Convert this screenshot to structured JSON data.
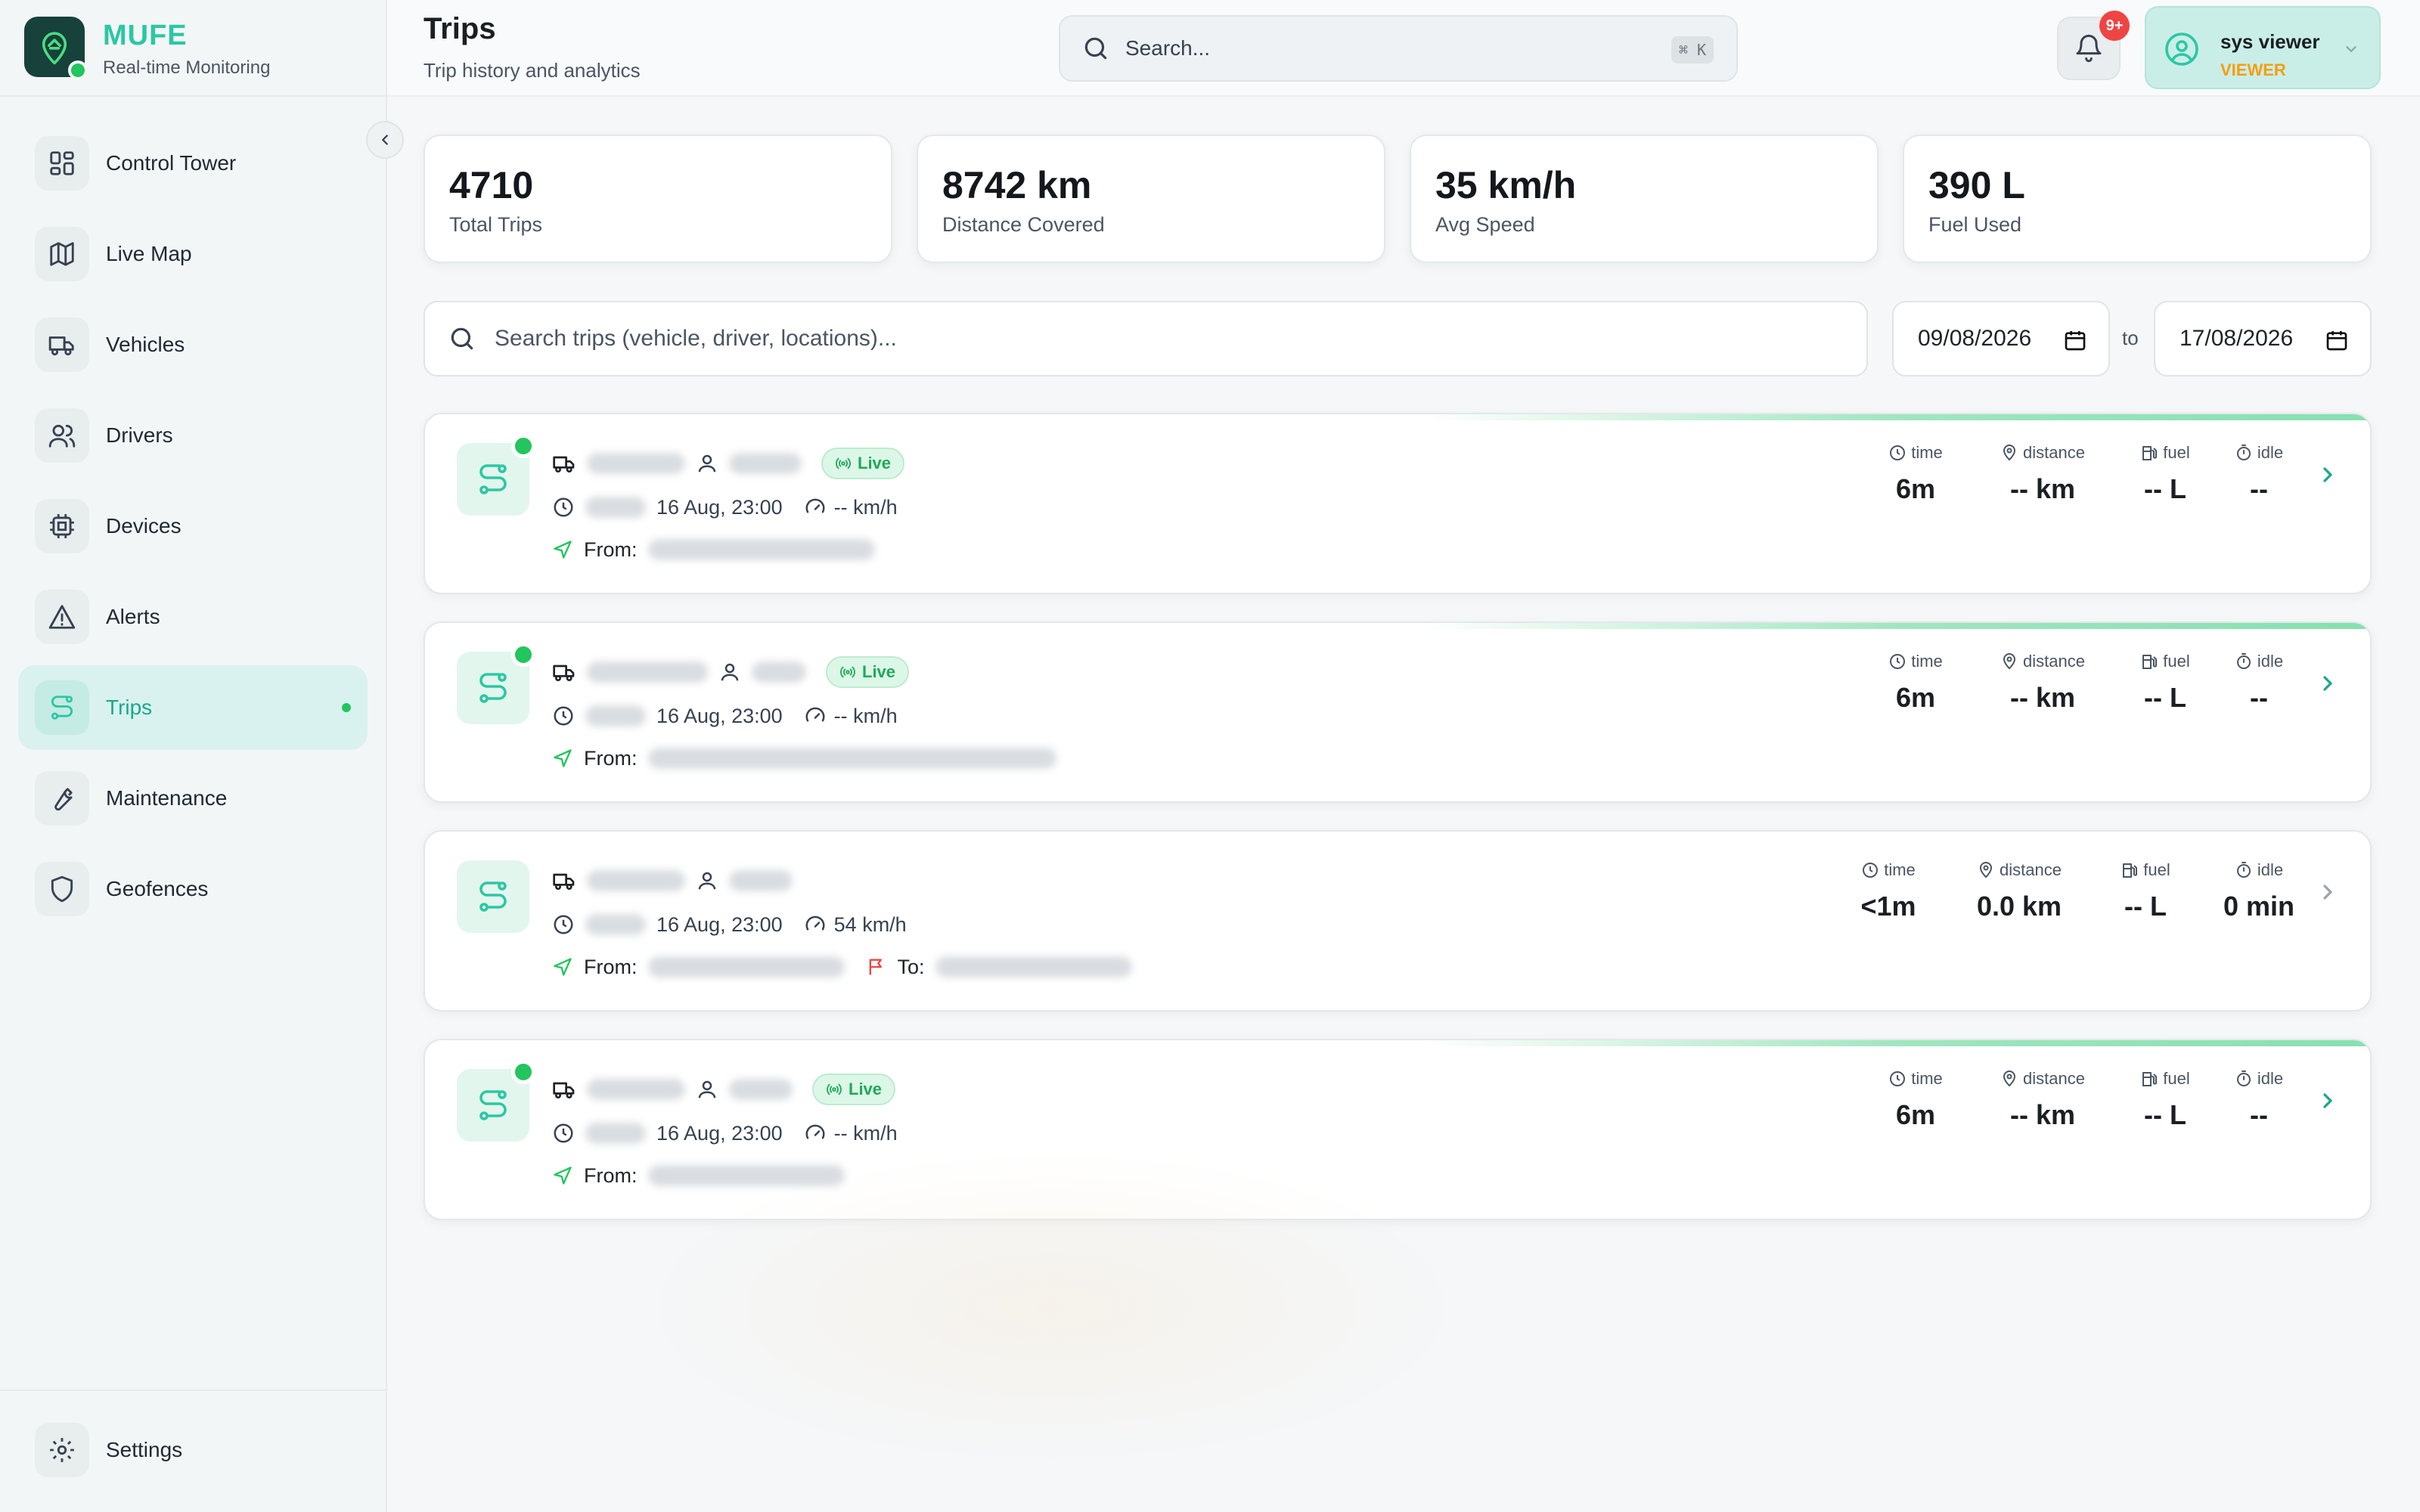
{
  "brand": {
    "name": "MUFE",
    "subtitle": "Real-time Monitoring"
  },
  "sidebar": {
    "items": [
      {
        "label": "Control Tower",
        "icon": "dashboard-icon",
        "active": false
      },
      {
        "label": "Live Map",
        "icon": "map-icon",
        "active": false
      },
      {
        "label": "Vehicles",
        "icon": "truck-icon",
        "active": false
      },
      {
        "label": "Drivers",
        "icon": "users-icon",
        "active": false
      },
      {
        "label": "Devices",
        "icon": "chip-icon",
        "active": false
      },
      {
        "label": "Alerts",
        "icon": "warning-icon",
        "active": false
      },
      {
        "label": "Trips",
        "icon": "route-icon",
        "active": true
      },
      {
        "label": "Maintenance",
        "icon": "wrench-icon",
        "active": false
      },
      {
        "label": "Geofences",
        "icon": "shield-icon",
        "active": false
      }
    ],
    "footer": {
      "label": "Settings",
      "icon": "gear-icon"
    }
  },
  "header": {
    "title": "Trips",
    "subtitle": "Trip history and analytics",
    "search_placeholder": "Search...",
    "search_shortcut": "⌘ K",
    "notifications_badge": "9+",
    "user": {
      "name": "sys viewer",
      "role": "VIEWER"
    }
  },
  "stats": [
    {
      "value": "4710",
      "label": "Total Trips"
    },
    {
      "value": "8742 km",
      "label": "Distance Covered"
    },
    {
      "value": "35 km/h",
      "label": "Avg Speed"
    },
    {
      "value": "390 L",
      "label": "Fuel Used"
    }
  ],
  "filters": {
    "search_placeholder": "Search trips (vehicle, driver, locations)...",
    "date_from": "09/08/2026",
    "date_separator": "to",
    "date_to": "17/08/2026"
  },
  "stat_headers": {
    "time": "time",
    "distance": "distance",
    "fuel": "fuel",
    "idle": "idle"
  },
  "trips": [
    {
      "live": true,
      "live_label": "Live",
      "date": "16 Aug, 23:00",
      "speed": "-- km/h",
      "from_label": "From:",
      "to_label": "",
      "time": "6m",
      "distance": "-- km",
      "fuel": "-- L",
      "idle": "--"
    },
    {
      "live": true,
      "live_label": "Live",
      "date": "16 Aug, 23:00",
      "speed": "-- km/h",
      "from_label": "From:",
      "to_label": "",
      "time": "6m",
      "distance": "-- km",
      "fuel": "-- L",
      "idle": "--"
    },
    {
      "live": false,
      "live_label": "",
      "date": "16 Aug, 23:00",
      "speed": "54 km/h",
      "from_label": "From:",
      "to_label": "To:",
      "time": "<1m",
      "distance": "0.0 km",
      "fuel": "-- L",
      "idle": "0 min"
    },
    {
      "live": true,
      "live_label": "Live",
      "date": "16 Aug, 23:00",
      "speed": "-- km/h",
      "from_label": "From:",
      "to_label": "",
      "time": "6m",
      "distance": "-- km",
      "fuel": "-- L",
      "idle": "--"
    }
  ],
  "colors": {
    "accent": "#2cc7a3",
    "live": "#22c55e",
    "badge": "#ef4444",
    "role": "#f59e0b"
  }
}
